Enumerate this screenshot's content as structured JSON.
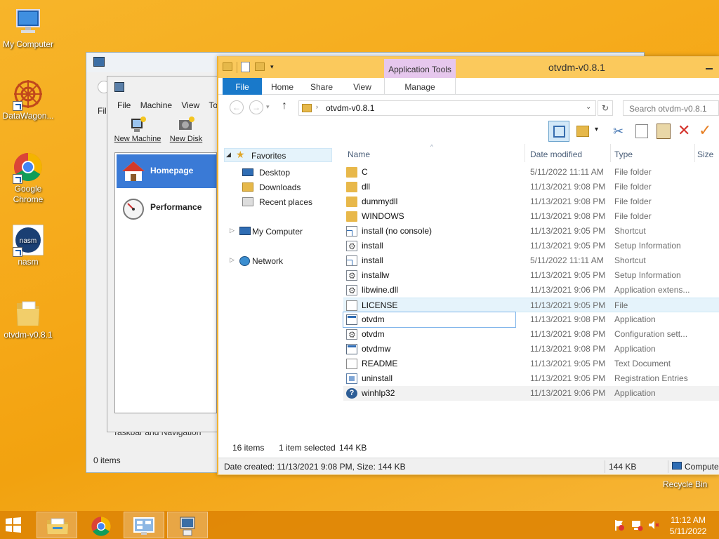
{
  "desktop": {
    "icons": [
      {
        "label": "My Computer"
      },
      {
        "label": "DataWagon..."
      },
      {
        "label": "Google Chrome"
      },
      {
        "label": "nasm"
      },
      {
        "label": "otvdm-v0.8.1"
      }
    ],
    "recycle_bin": "Recycle Bin"
  },
  "bg_window": {
    "menu_file_trunc": "Fil",
    "status": "0 items",
    "footer_text": "Taskbar and Navigation"
  },
  "vm_window": {
    "menu": [
      "File",
      "Machine",
      "View",
      "To"
    ],
    "toolbar": [
      "New Machine",
      "New Disk"
    ],
    "side_items": [
      "Homepage",
      "Performance"
    ]
  },
  "explorer": {
    "title": "otvdm-v0.8.1",
    "contextual_tab_group": "Application Tools",
    "tabs": [
      "File",
      "Home",
      "Share",
      "View",
      "Manage"
    ],
    "address_path": "otvdm-v0.8.1",
    "search_placeholder": "Search otvdm-v0.8.1",
    "nav": {
      "favorites": "Favorites",
      "favorite_items": [
        "Desktop",
        "Downloads",
        "Recent places"
      ],
      "my_computer": "My Computer",
      "network": "Network"
    },
    "columns": [
      "Name",
      "Date modified",
      "Type",
      "Size"
    ],
    "files": [
      {
        "name": "C",
        "date": "5/11/2022 11:11 AM",
        "type": "File folder",
        "icon": "folder-icon"
      },
      {
        "name": "dll",
        "date": "11/13/2021 9:08 PM",
        "type": "File folder",
        "icon": "folder-icon"
      },
      {
        "name": "dummydll",
        "date": "11/13/2021 9:08 PM",
        "type": "File folder",
        "icon": "folder-icon"
      },
      {
        "name": "WINDOWS",
        "date": "11/13/2021 9:08 PM",
        "type": "File folder",
        "icon": "folder-icon"
      },
      {
        "name": "install (no console)",
        "date": "11/13/2021 9:05 PM",
        "type": "Shortcut",
        "icon": "shortcut-icon"
      },
      {
        "name": "install",
        "date": "11/13/2021 9:05 PM",
        "type": "Setup Information",
        "icon": "setup-info-icon"
      },
      {
        "name": "install",
        "date": "5/11/2022 11:11 AM",
        "type": "Shortcut",
        "icon": "shortcut-icon"
      },
      {
        "name": "installw",
        "date": "11/13/2021 9:05 PM",
        "type": "Setup Information",
        "icon": "setup-info-icon"
      },
      {
        "name": "libwine.dll",
        "date": "11/13/2021 9:06 PM",
        "type": "Application extens...",
        "icon": "dll-icon"
      },
      {
        "name": "LICENSE",
        "date": "11/13/2021 9:05 PM",
        "type": "File",
        "icon": "file-icon"
      },
      {
        "name": "otvdm",
        "date": "11/13/2021 9:08 PM",
        "type": "Application",
        "icon": "application-icon"
      },
      {
        "name": "otvdm",
        "date": "11/13/2021 9:08 PM",
        "type": "Configuration sett...",
        "icon": "config-icon"
      },
      {
        "name": "otvdmw",
        "date": "11/13/2021 9:08 PM",
        "type": "Application",
        "icon": "application-icon"
      },
      {
        "name": "README",
        "date": "11/13/2021 9:05 PM",
        "type": "Text Document",
        "icon": "text-document-icon"
      },
      {
        "name": "uninstall",
        "date": "11/13/2021 9:05 PM",
        "type": "Registration Entries",
        "icon": "registry-icon"
      },
      {
        "name": "winhlp32",
        "date": "11/13/2021 9:06 PM",
        "type": "Application",
        "icon": "help-app-icon"
      }
    ],
    "status": {
      "item_count": "16 items",
      "selected": "1 item selected",
      "selected_size": "144 KB"
    },
    "details_bar": {
      "info": "Date created: 11/13/2021 9:08 PM, Size: 144 KB",
      "size": "144 KB",
      "location": "Computer"
    }
  },
  "taskbar": {
    "time": "11:12 AM",
    "date": "5/11/2022"
  }
}
